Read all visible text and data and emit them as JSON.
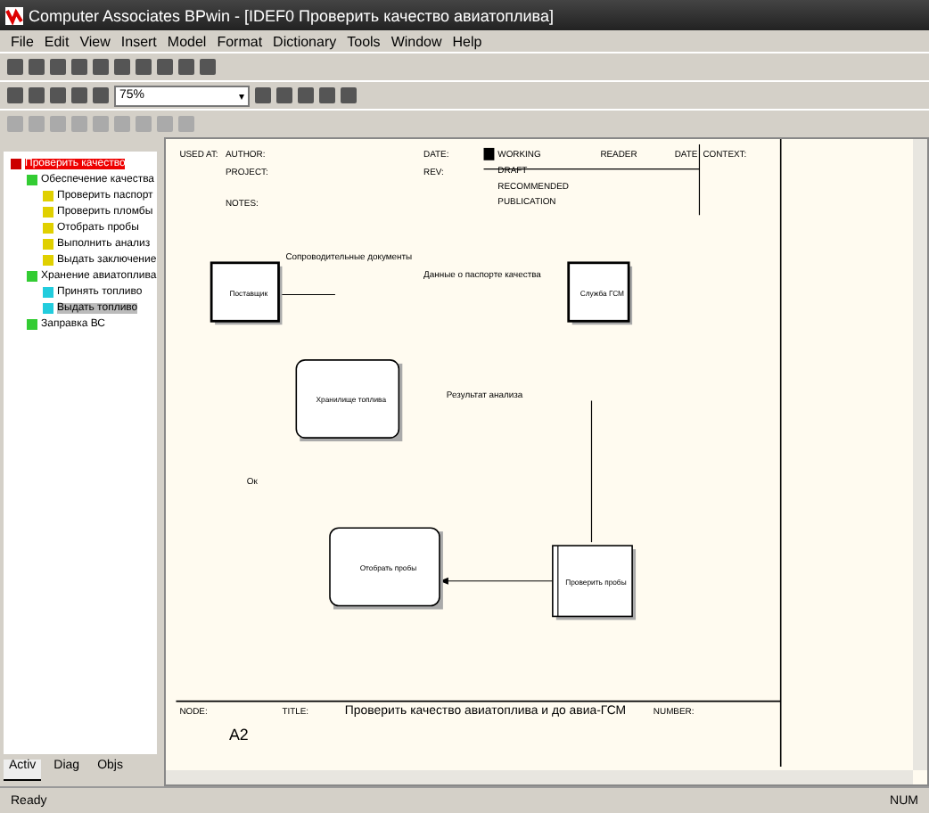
{
  "window": {
    "title": "Computer Associates BPwin - [IDEF0 Проверить качество авиатоплива]"
  },
  "menu": [
    "File",
    "Edit",
    "View",
    "Insert",
    "Model",
    "Format",
    "Dictionary",
    "Tools",
    "Window",
    "Help"
  ],
  "zoom_combo": {
    "value": "75%",
    "arrow": "▾"
  },
  "tree": {
    "items": [
      {
        "label": "Проверить качество",
        "selected": false,
        "highlighted": true,
        "kind": "root",
        "children": [
          {
            "label": "Обеспечение качества",
            "selected": false,
            "highlighted": false,
            "kind": "process",
            "children": [
              {
                "label": "Проверить паспорт",
                "selected": false,
                "highlighted": false,
                "kind": "activity"
              },
              {
                "label": "Проверить пломбы",
                "selected": false,
                "highlighted": false,
                "kind": "activity"
              },
              {
                "label": "Отобрать пробы",
                "selected": false,
                "highlighted": false,
                "kind": "activity"
              },
              {
                "label": "Выполнить анализ",
                "selected": false,
                "highlighted": false,
                "kind": "activity"
              },
              {
                "label": "Выдать заключение",
                "selected": false,
                "highlighted": false,
                "kind": "activity"
              }
            ]
          },
          {
            "label": "Хранение авиатоплива",
            "selected": false,
            "highlighted": false,
            "kind": "process",
            "children": [
              {
                "label": "Принять топливо",
                "selected": false,
                "highlighted": false,
                "kind": "store"
              },
              {
                "label": "Выдать топливо",
                "selected": true,
                "highlighted": false,
                "kind": "store"
              }
            ]
          },
          {
            "label": "Заправка ВС",
            "selected": false,
            "highlighted": false,
            "kind": "process"
          }
        ]
      }
    ]
  },
  "panel_tabs": [
    {
      "label": "Activ",
      "selected": true
    },
    {
      "label": "Diag",
      "selected": false
    },
    {
      "label": "Objs",
      "selected": false
    }
  ],
  "frame": {
    "used_at": "USED AT:",
    "author": "AUTHOR:",
    "project": "PROJECT:",
    "notes": "NOTES:",
    "date": "DATE:",
    "rev": "REV:",
    "status": [
      {
        "label": "WORKING",
        "selected": true
      },
      {
        "label": "DRAFT",
        "selected": false
      },
      {
        "label": "RECOMMENDED",
        "selected": false
      },
      {
        "label": "PUBLICATION",
        "selected": false
      }
    ],
    "reader": "READER",
    "date2": "DATE",
    "context": "CONTEXT:",
    "node_label": "NODE:",
    "node": "A2",
    "title_label": "TITLE:",
    "title": "Проверить качество  авиатоплива и до авиа-ГСМ",
    "number_label": "NUMBER:"
  },
  "diagram": {
    "boxes": [
      {
        "text": "Поставщик",
        "kind": "external"
      },
      {
        "text": "Служба ГСМ",
        "kind": "external"
      },
      {
        "text": "Хранилище топлива",
        "kind": "store"
      },
      {
        "text": "Отобрать пробы",
        "kind": "store"
      },
      {
        "text": "Проверить пробы",
        "kind": "activity"
      }
    ],
    "labels": [
      "Сопроводительные документы",
      "Данные о паспорте качества",
      "Результат анализа",
      "Ок"
    ]
  },
  "status_bar": {
    "text": "Ready",
    "indicator": "NUM"
  }
}
